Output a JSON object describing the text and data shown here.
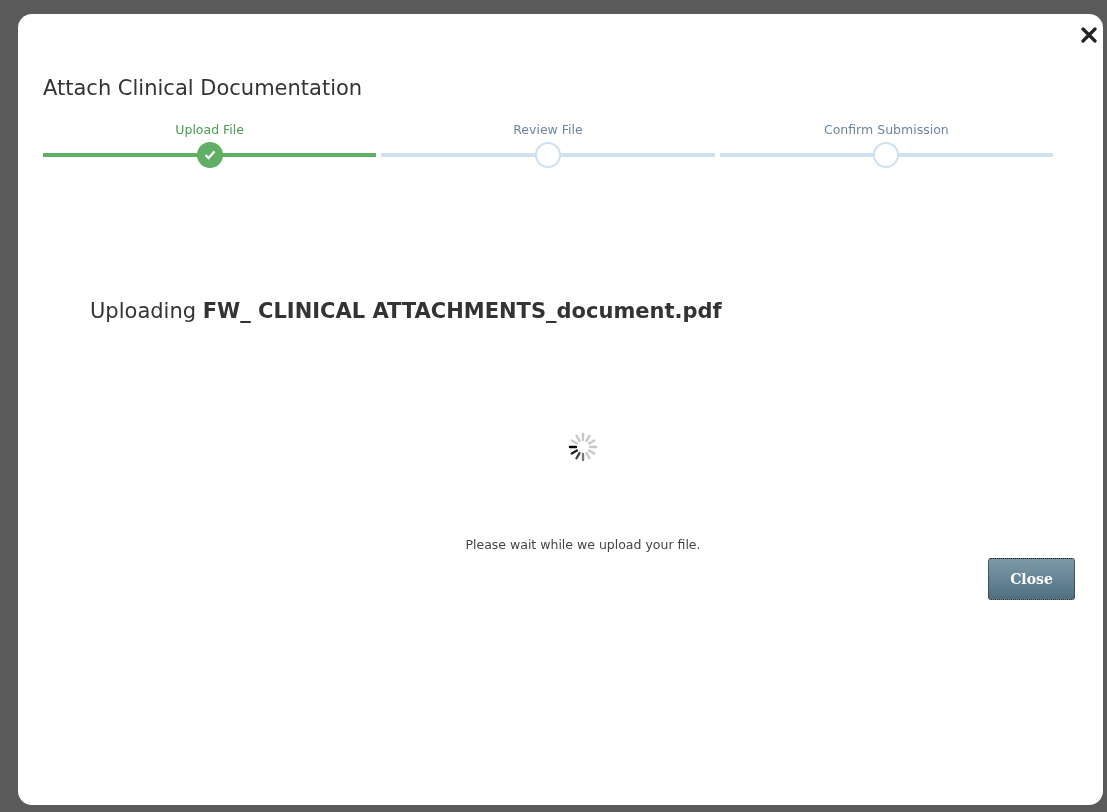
{
  "dialog": {
    "title": "Attach Clinical Documentation",
    "steps": [
      {
        "label": "Upload File",
        "completed": true
      },
      {
        "label": "Review File",
        "completed": false
      },
      {
        "label": "Confirm Submission",
        "completed": false
      }
    ],
    "status": "Uploading **FW_ CLINICAL ATTACHMENTS_document.pdf**",
    "message": "Please wait while we upload your file.",
    "buttons": [
      {
        "label": "Close"
      }
    ]
  }
}
